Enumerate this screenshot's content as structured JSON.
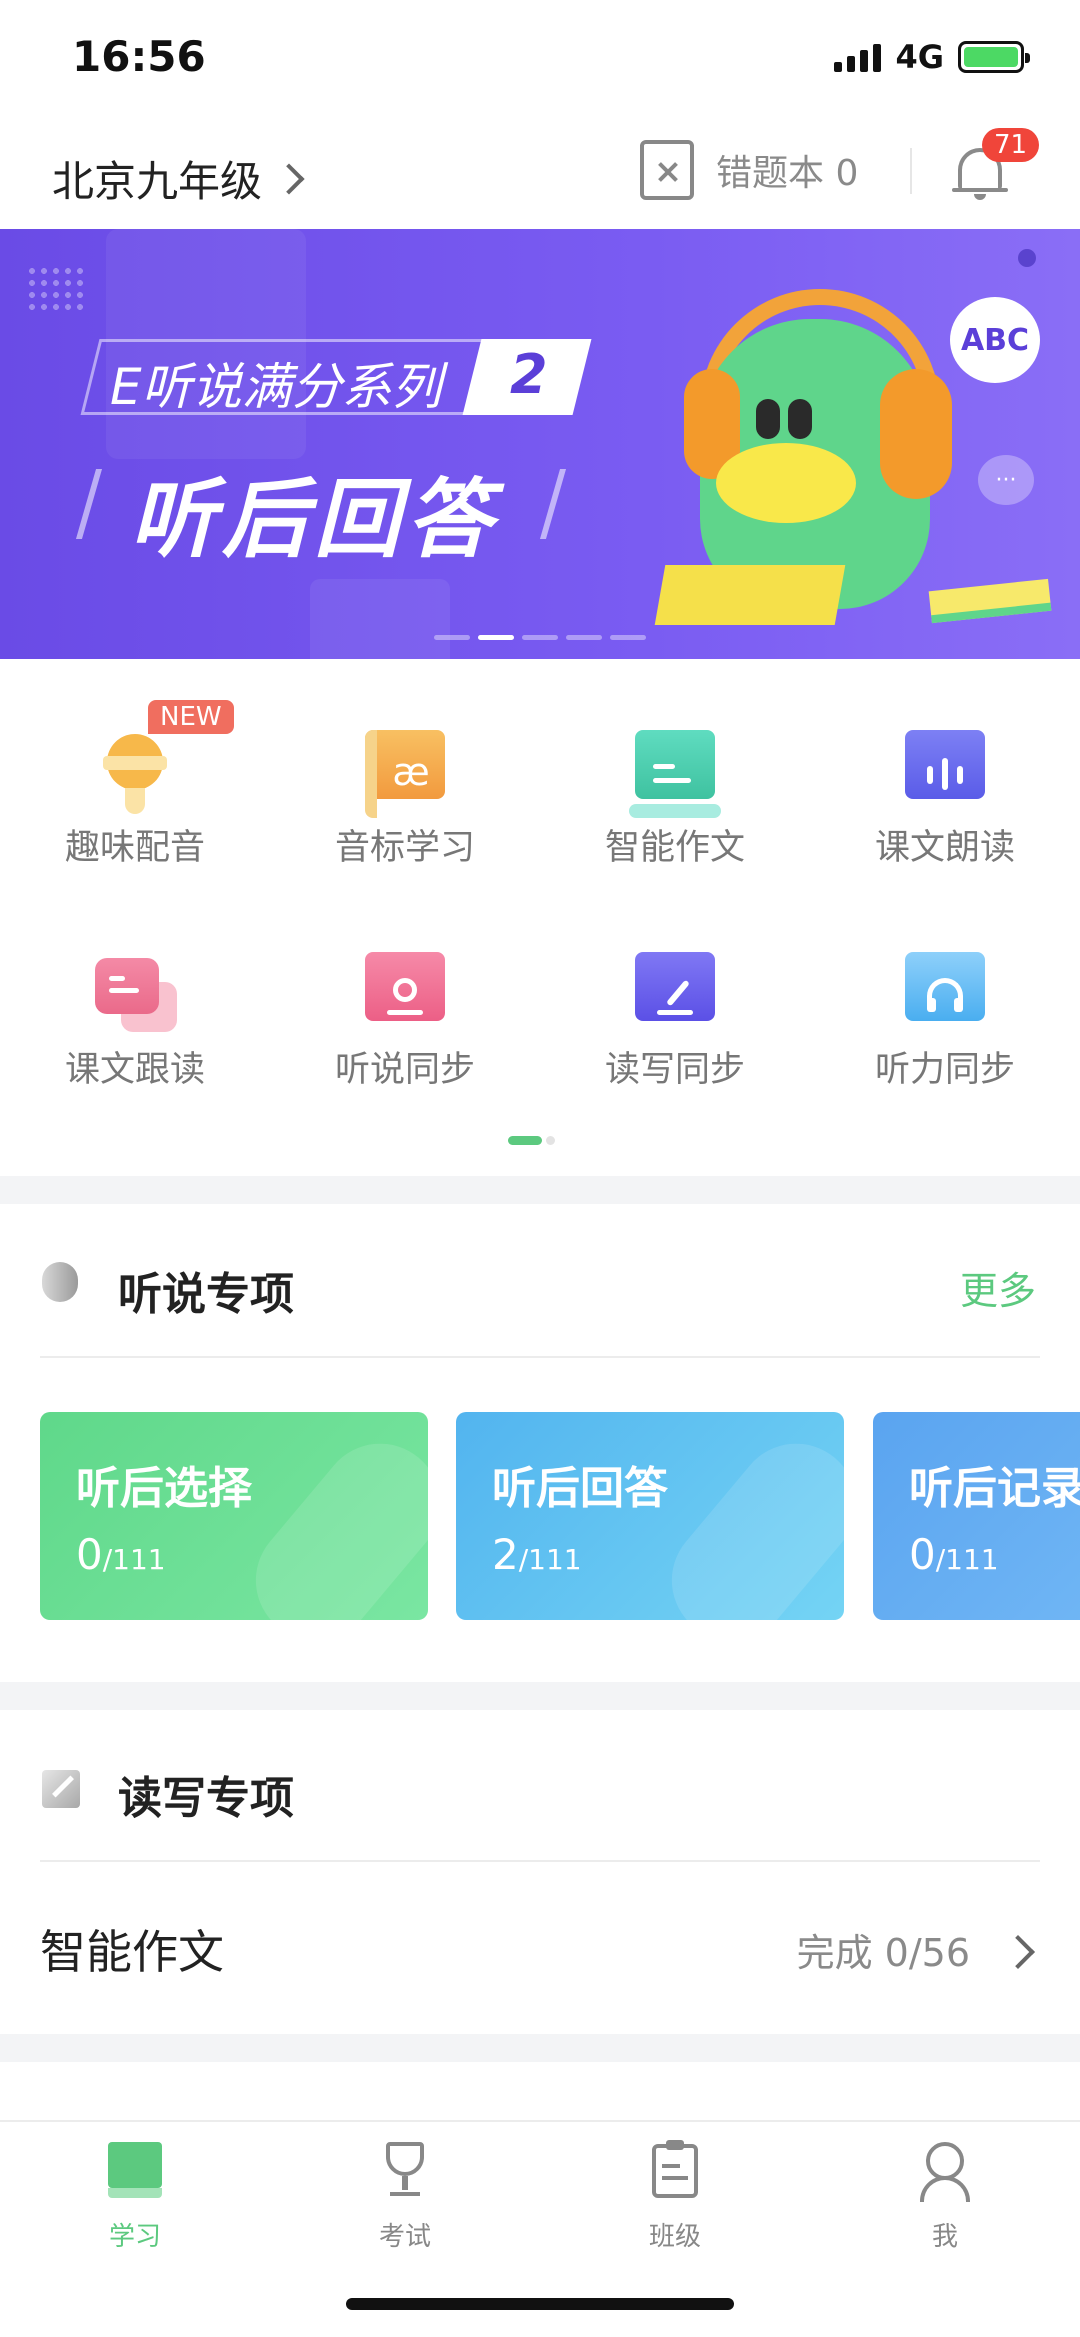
{
  "status_bar": {
    "time": "16:56",
    "network": "4G"
  },
  "header": {
    "grade": "北京九年级",
    "error_book_label": "错题本 0",
    "notification_count": "71"
  },
  "banner": {
    "subtitle": "E听说满分系列",
    "series_number": "2",
    "title": "听后回答",
    "abc_text": "ABC",
    "chat_text": "···",
    "active_index": 1,
    "slide_count": 5
  },
  "grid": {
    "new_badge": "NEW",
    "items": [
      {
        "label": "趣味配音",
        "icon": "microphone-icon",
        "color": "#f7b84a"
      },
      {
        "label": "音标学习",
        "icon": "phonetic-book-icon",
        "color": "#f4a24a",
        "glyph": "æ"
      },
      {
        "label": "智能作文",
        "icon": "essay-scroll-icon",
        "color": "#4fd0b0"
      },
      {
        "label": "课文朗读",
        "icon": "text-reading-icon",
        "color": "#6c6ef0"
      },
      {
        "label": "课文跟读",
        "icon": "follow-reading-icon",
        "color": "#f07a9a"
      },
      {
        "label": "听说同步",
        "icon": "listen-speak-icon",
        "color": "#f06a8a"
      },
      {
        "label": "读写同步",
        "icon": "read-write-icon",
        "color": "#6a5ff0"
      },
      {
        "label": "听力同步",
        "icon": "headphone-doc-icon",
        "color": "#4fb0f0"
      }
    ]
  },
  "listening_section": {
    "title": "听说专项",
    "more": "更多",
    "cards": [
      {
        "title": "听后选择",
        "done": "0",
        "total": "/111",
        "color_a": "#5fd88a",
        "color_b": "#7ae6a2"
      },
      {
        "title": "听后回答",
        "done": "2",
        "total": "/111",
        "color_a": "#52b4ef",
        "color_b": "#74d4f4"
      },
      {
        "title": "听后记录",
        "done": "0",
        "total": "/111",
        "color_a": "#5aa4f0",
        "color_b": "#78bdf6"
      }
    ]
  },
  "writing_section": {
    "title": "读写专项",
    "row_label": "智能作文",
    "row_status": "完成  0/56"
  },
  "tabbar": {
    "tabs": [
      {
        "label": "学习",
        "icon": "book-icon"
      },
      {
        "label": "考试",
        "icon": "trophy-icon"
      },
      {
        "label": "班级",
        "icon": "clipboard-icon"
      },
      {
        "label": "我",
        "icon": "user-icon"
      }
    ]
  }
}
